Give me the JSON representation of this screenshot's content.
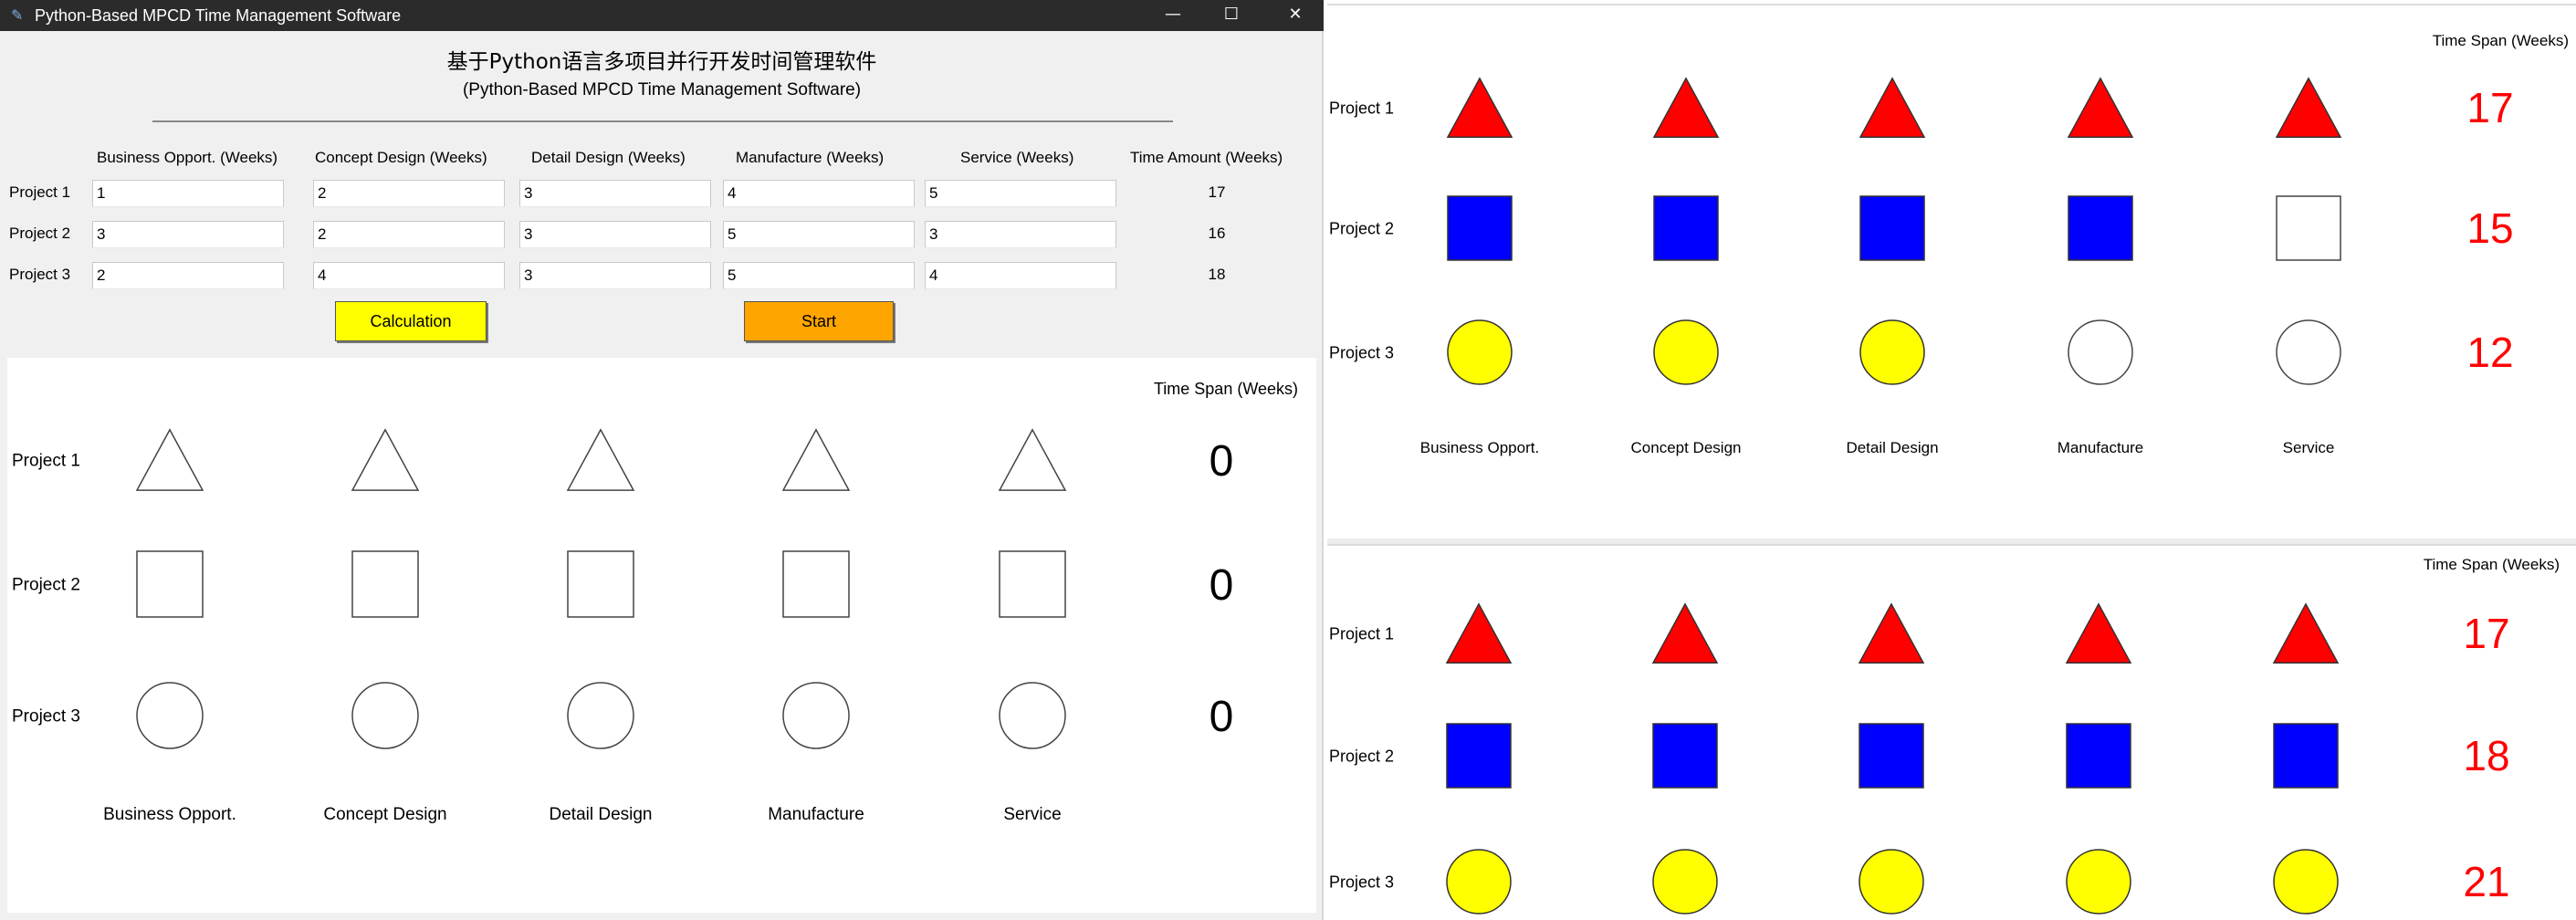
{
  "window": {
    "title": "Python-Based MPCD Time Management Software",
    "minimize_glyph": "—",
    "maximize_glyph": "☐",
    "close_glyph": "✕",
    "app_icon": "feather-icon"
  },
  "header": {
    "title_cn": "基于Python语言多项目并行开发时间管理软件",
    "subtitle": "(Python-Based MPCD Time Management Software)"
  },
  "input_table": {
    "columns": [
      "Business Opport. (Weeks)",
      "Concept Design (Weeks)",
      "Detail Design (Weeks)",
      "Manufacture (Weeks)",
      "Service (Weeks)",
      "Time Amount (Weeks)"
    ],
    "rows": [
      {
        "label": "Project 1",
        "values": [
          "1",
          "2",
          "3",
          "4",
          "5"
        ],
        "total": "17"
      },
      {
        "label": "Project 2",
        "values": [
          "3",
          "2",
          "3",
          "5",
          "3"
        ],
        "total": "16"
      },
      {
        "label": "Project 3",
        "values": [
          "2",
          "4",
          "3",
          "5",
          "4"
        ],
        "total": "18"
      }
    ]
  },
  "buttons": {
    "calculation": "Calculation",
    "start": "Start"
  },
  "colors": {
    "triangle": "#ff0000",
    "square": "#0000ff",
    "circle": "#ffff00",
    "calc_button": "#ffff00",
    "start_button": "#ffa500",
    "span_number": "#ff0000"
  },
  "canvases": [
    {
      "id": "left",
      "span_header": "Time Span (Weeks)",
      "rows": [
        {
          "label": "Project 1",
          "shape": "triangle",
          "filled": [
            false,
            false,
            false,
            false,
            false
          ],
          "span": "0"
        },
        {
          "label": "Project 2",
          "shape": "square",
          "filled": [
            false,
            false,
            false,
            false,
            false
          ],
          "span": "0"
        },
        {
          "label": "Project 3",
          "shape": "circle",
          "filled": [
            false,
            false,
            false,
            false,
            false
          ],
          "span": "0"
        }
      ],
      "stages": [
        "Business Opport.",
        "Concept Design",
        "Detail Design",
        "Manufacture",
        "Service"
      ]
    },
    {
      "id": "right-top",
      "span_header": "Time Span (Weeks)",
      "rows": [
        {
          "label": "Project 1",
          "shape": "triangle",
          "filled": [
            true,
            true,
            true,
            true,
            true
          ],
          "span": "17"
        },
        {
          "label": "Project 2",
          "shape": "square",
          "filled": [
            true,
            true,
            true,
            true,
            false
          ],
          "span": "15"
        },
        {
          "label": "Project 3",
          "shape": "circle",
          "filled": [
            true,
            true,
            true,
            false,
            false
          ],
          "span": "12"
        }
      ],
      "stages": [
        "Business Opport.",
        "Concept Design",
        "Detail Design",
        "Manufacture",
        "Service"
      ]
    },
    {
      "id": "right-bottom",
      "span_header": "Time Span (Weeks)",
      "rows": [
        {
          "label": "Project 1",
          "shape": "triangle",
          "filled": [
            true,
            true,
            true,
            true,
            true
          ],
          "span": "17"
        },
        {
          "label": "Project 2",
          "shape": "square",
          "filled": [
            true,
            true,
            true,
            true,
            true
          ],
          "span": "18"
        },
        {
          "label": "Project 3",
          "shape": "circle",
          "filled": [
            true,
            true,
            true,
            true,
            true
          ],
          "span": "21"
        }
      ],
      "stages": []
    }
  ]
}
